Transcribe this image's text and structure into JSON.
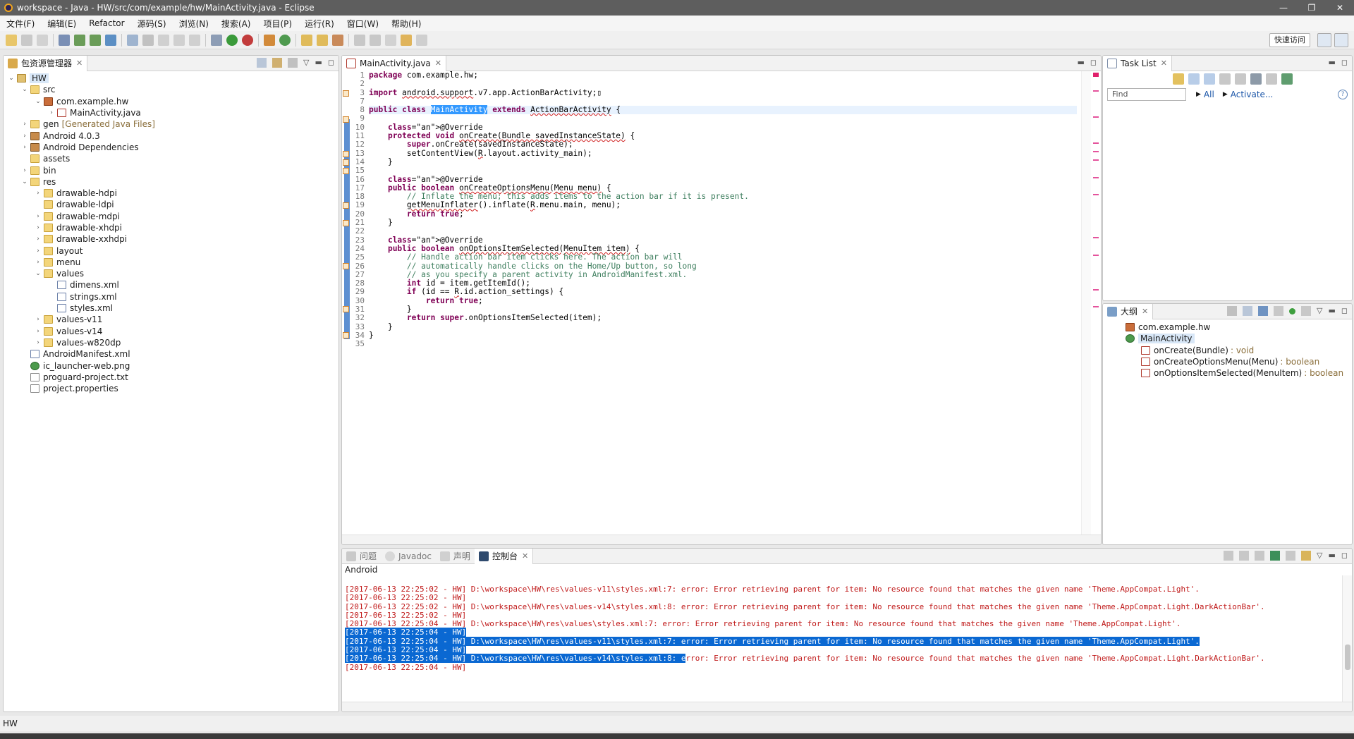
{
  "window": {
    "title": "workspace - Java - HW/src/com/example/hw/MainActivity.java - Eclipse",
    "controls": [
      "—",
      "❐",
      "✕"
    ]
  },
  "menu": [
    "文件(F)",
    "编辑(E)",
    "Refactor",
    "源码(S)",
    "浏览(N)",
    "搜索(A)",
    "项目(P)",
    "运行(R)",
    "窗口(W)",
    "帮助(H)"
  ],
  "toolbar": {
    "quick_access": "快速访问"
  },
  "explorer": {
    "tab": "包资源管理器",
    "tree": [
      {
        "label": "HW",
        "icon": "project-icon",
        "twisty": "⌄",
        "selected": true
      },
      {
        "label": "src",
        "icon": "source-folder-icon",
        "twisty": "⌄"
      },
      {
        "label": "com.example.hw",
        "icon": "package-icon",
        "twisty": "⌄"
      },
      {
        "label": "MainActivity.java",
        "icon": "java-file-icon",
        "twisty": "›"
      },
      {
        "label": "gen",
        "suffix": "[Generated Java Files]",
        "icon": "folder-icon",
        "twisty": "›"
      },
      {
        "label": "Android 4.0.3",
        "icon": "library-icon",
        "twisty": "›"
      },
      {
        "label": "Android Dependencies",
        "icon": "library-icon",
        "twisty": "›"
      },
      {
        "label": "assets",
        "icon": "folder-icon",
        "twisty": ""
      },
      {
        "label": "bin",
        "icon": "folder-icon",
        "twisty": "›"
      },
      {
        "label": "res",
        "icon": "folder-icon",
        "twisty": "⌄"
      },
      {
        "label": "drawable-hdpi",
        "icon": "folder-icon",
        "twisty": "›"
      },
      {
        "label": "drawable-ldpi",
        "icon": "folder-icon",
        "twisty": ""
      },
      {
        "label": "drawable-mdpi",
        "icon": "folder-icon",
        "twisty": "›"
      },
      {
        "label": "drawable-xhdpi",
        "icon": "folder-icon",
        "twisty": "›"
      },
      {
        "label": "drawable-xxhdpi",
        "icon": "folder-icon",
        "twisty": "›"
      },
      {
        "label": "layout",
        "icon": "folder-icon",
        "twisty": "›"
      },
      {
        "label": "menu",
        "icon": "folder-icon",
        "twisty": "›"
      },
      {
        "label": "values",
        "icon": "folder-icon",
        "twisty": "⌄"
      },
      {
        "label": "dimens.xml",
        "icon": "xml-file-icon",
        "twisty": ""
      },
      {
        "label": "strings.xml",
        "icon": "xml-file-icon",
        "twisty": ""
      },
      {
        "label": "styles.xml",
        "icon": "xml-file-icon",
        "twisty": ""
      },
      {
        "label": "values-v11",
        "icon": "folder-icon",
        "twisty": "›"
      },
      {
        "label": "values-v14",
        "icon": "folder-icon",
        "twisty": "›"
      },
      {
        "label": "values-w820dp",
        "icon": "folder-icon",
        "twisty": "›"
      },
      {
        "label": "AndroidManifest.xml",
        "icon": "xml-file-icon",
        "twisty": ""
      },
      {
        "label": "ic_launcher-web.png",
        "icon": "image-file-icon",
        "twisty": ""
      },
      {
        "label": "proguard-project.txt",
        "icon": "text-file-icon",
        "twisty": ""
      },
      {
        "label": "project.properties",
        "icon": "text-file-icon",
        "twisty": ""
      }
    ]
  },
  "editor": {
    "tab": "MainActivity.java",
    "lines": [
      {
        "n": "1",
        "code": "package com.example.hw;"
      },
      {
        "n": "2",
        "code": ""
      },
      {
        "n": "3",
        "code": "import android.support.v7.app.ActionBarActivity;▯"
      },
      {
        "n": "7",
        "code": ""
      },
      {
        "n": "8",
        "code": "public class MainActivity extends ActionBarActivity {"
      },
      {
        "n": "9",
        "code": ""
      },
      {
        "n": "10",
        "code": "    @Override"
      },
      {
        "n": "11",
        "code": "    protected void onCreate(Bundle savedInstanceState) {"
      },
      {
        "n": "12",
        "code": "        super.onCreate(savedInstanceState);"
      },
      {
        "n": "13",
        "code": "        setContentView(R.layout.activity_main);"
      },
      {
        "n": "14",
        "code": "    }"
      },
      {
        "n": "15",
        "code": ""
      },
      {
        "n": "16",
        "code": "    @Override"
      },
      {
        "n": "17",
        "code": "    public boolean onCreateOptionsMenu(Menu menu) {"
      },
      {
        "n": "18",
        "code": "        // Inflate the menu; this adds items to the action bar if it is present."
      },
      {
        "n": "19",
        "code": "        getMenuInflater().inflate(R.menu.main, menu);"
      },
      {
        "n": "20",
        "code": "        return true;"
      },
      {
        "n": "21",
        "code": "    }"
      },
      {
        "n": "22",
        "code": ""
      },
      {
        "n": "23",
        "code": "    @Override"
      },
      {
        "n": "24",
        "code": "    public boolean onOptionsItemSelected(MenuItem item) {"
      },
      {
        "n": "25",
        "code": "        // Handle action bar item clicks here. The action bar will"
      },
      {
        "n": "26",
        "code": "        // automatically handle clicks on the Home/Up button, so long"
      },
      {
        "n": "27",
        "code": "        // as you specify a parent activity in AndroidManifest.xml."
      },
      {
        "n": "28",
        "code": "        int id = item.getItemId();"
      },
      {
        "n": "29",
        "code": "        if (id == R.id.action_settings) {"
      },
      {
        "n": "30",
        "code": "            return true;"
      },
      {
        "n": "31",
        "code": "        }"
      },
      {
        "n": "32",
        "code": "        return super.onOptionsItemSelected(item);"
      },
      {
        "n": "33",
        "code": "    }"
      },
      {
        "n": "34",
        "code": "}"
      },
      {
        "n": "35",
        "code": ""
      }
    ]
  },
  "tasklist": {
    "tab": "Task List",
    "find_placeholder": "Find",
    "all": "All",
    "activate": "Activate..."
  },
  "outline": {
    "tab": "大纲",
    "items": [
      {
        "label": "com.example.hw",
        "ret": ""
      },
      {
        "label": "MainActivity",
        "ret": ""
      },
      {
        "label": "onCreate(Bundle)",
        "ret": ": void"
      },
      {
        "label": "onCreateOptionsMenu(Menu)",
        "ret": ": boolean"
      },
      {
        "label": "onOptionsItemSelected(MenuItem)",
        "ret": ": boolean"
      }
    ]
  },
  "bottom": {
    "tabs": [
      "问题",
      "Javadoc",
      "声明",
      "控制台"
    ],
    "console_name": "Android",
    "lines": [
      "[2017-06-13 22:25:02 - HW] D:\\workspace\\HW\\res\\values-v11\\styles.xml:7: error: Error retrieving parent for item: No resource found that matches the given name 'Theme.AppCompat.Light'.",
      "[2017-06-13 22:25:02 - HW]",
      "[2017-06-13 22:25:02 - HW] D:\\workspace\\HW\\res\\values-v14\\styles.xml:8: error: Error retrieving parent for item: No resource found that matches the given name 'Theme.AppCompat.Light.DarkActionBar'.",
      "[2017-06-13 22:25:02 - HW]",
      "[2017-06-13 22:25:04 - HW] D:\\workspace\\HW\\res\\values\\styles.xml:7: error: Error retrieving parent for item: No resource found that matches the given name 'Theme.AppCompat.Light'.",
      "[2017-06-13 22:25:04 - HW]",
      "[2017-06-13 22:25:04 - HW] D:\\workspace\\HW\\res\\values-v11\\styles.xml:7: error: Error retrieving parent for item: No resource found that matches the given name 'Theme.AppCompat.Light'.",
      "[2017-06-13 22:25:04 - HW]",
      "[2017-06-13 22:25:04 - HW] D:\\workspace\\HW\\res\\values-v14\\styles.xml:8: error: Error retrieving parent for item: No resource found that matches the given name 'Theme.AppCompat.Light.DarkActionBar'.",
      "[2017-06-13 22:25:04 - HW]"
    ]
  },
  "status": {
    "left": "HW"
  },
  "colors": {
    "keyword": "#7f0055",
    "comment": "#3f7f5f",
    "error_text": "#c01a1a",
    "selection": "#0a68d2"
  }
}
